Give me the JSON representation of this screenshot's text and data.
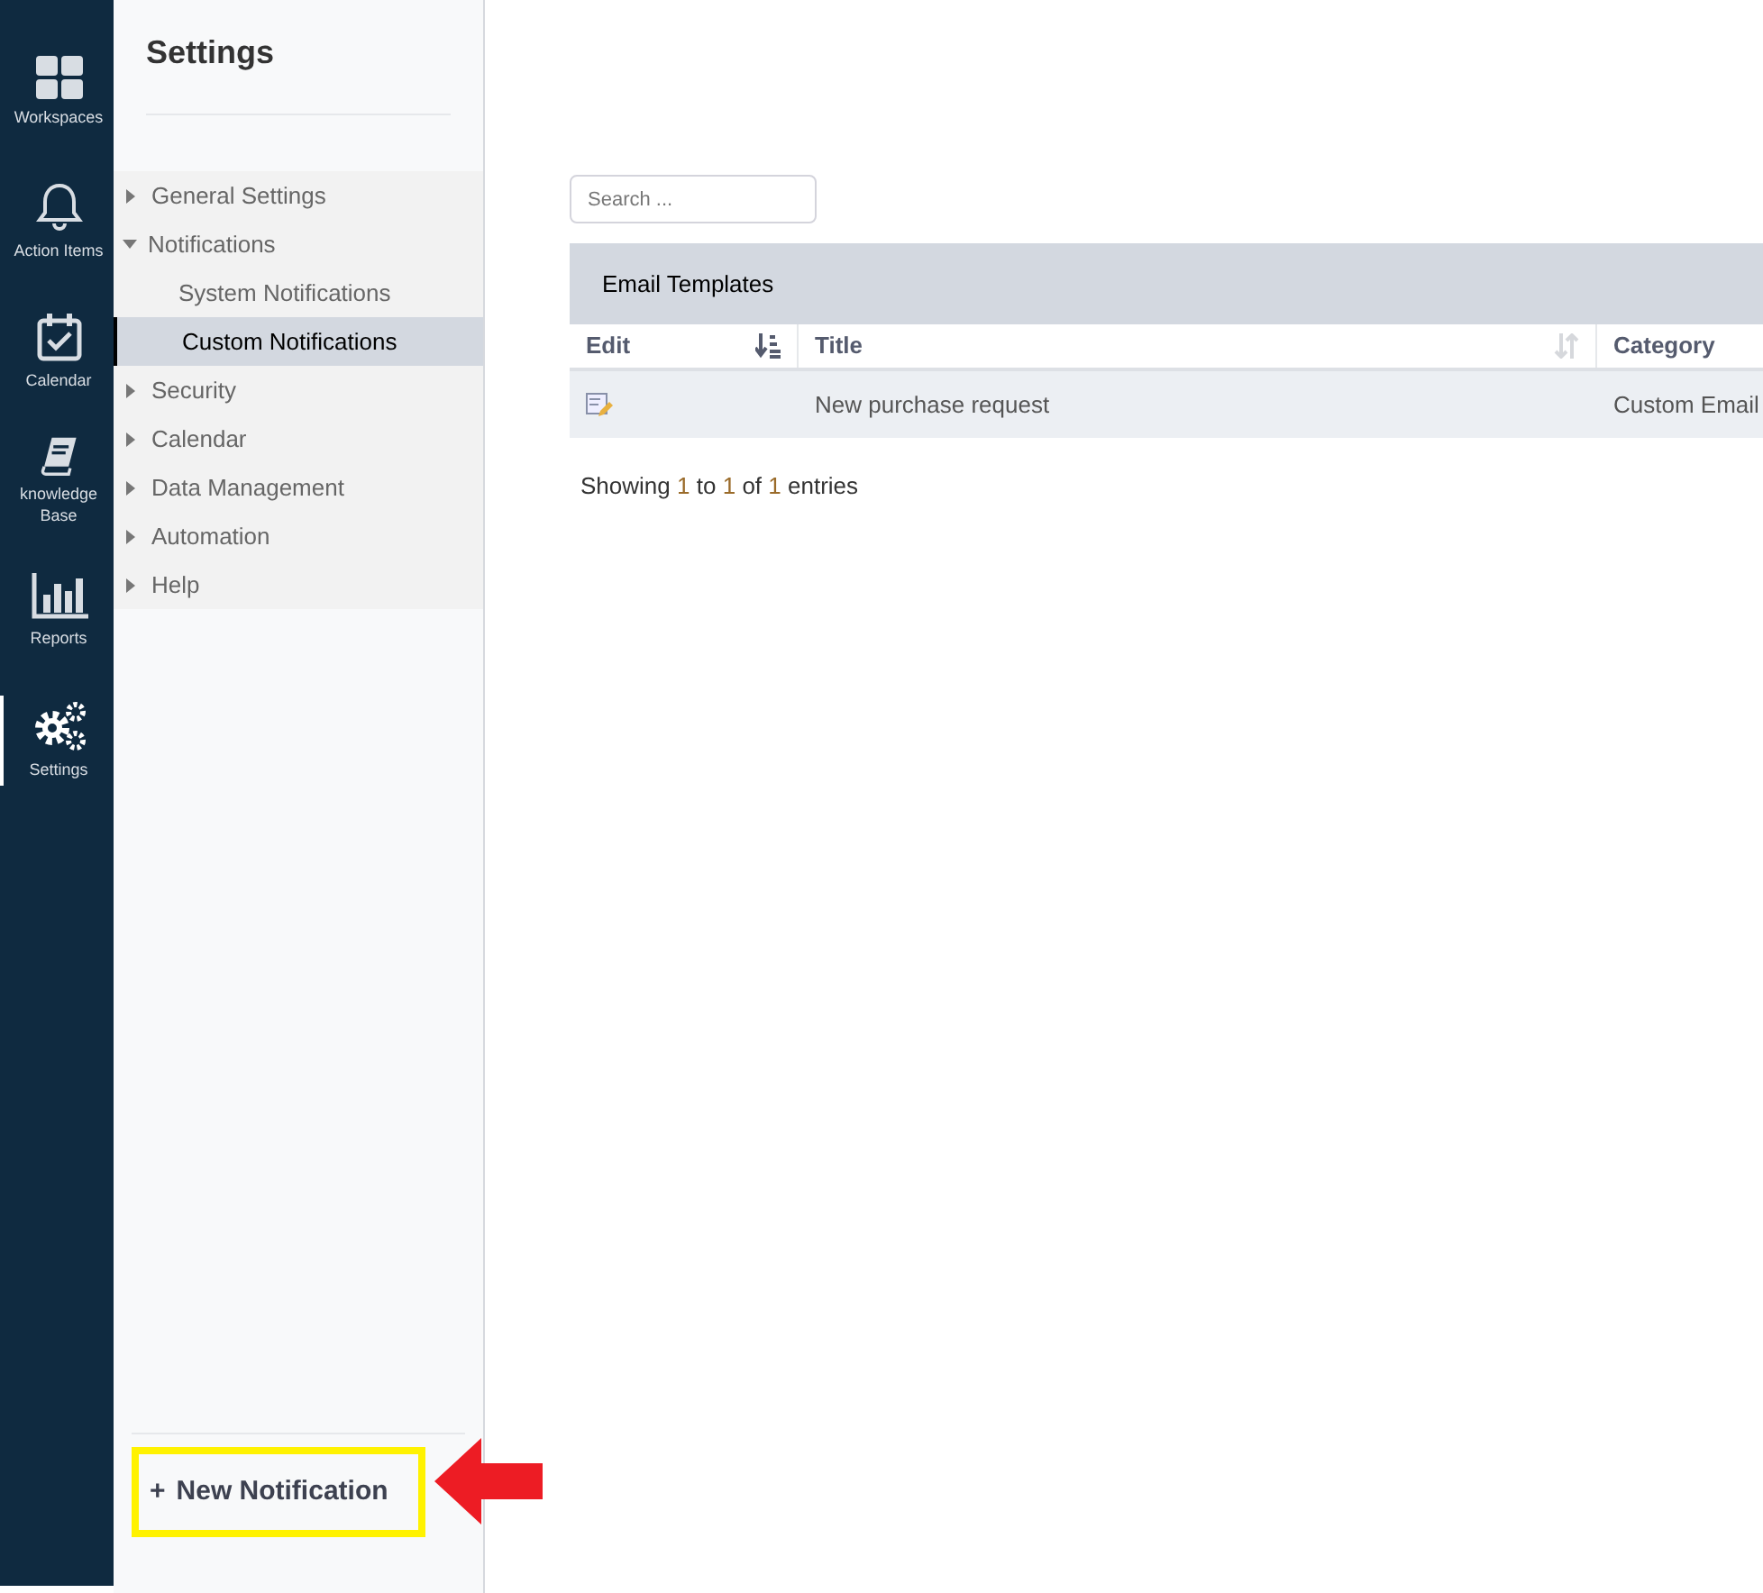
{
  "nav_rail": [
    {
      "kind": "workspaces",
      "label": "Workspaces",
      "selected": false
    },
    {
      "kind": "bell",
      "label": "Action Items",
      "selected": false
    },
    {
      "kind": "calendar",
      "label": "Calendar",
      "selected": false
    },
    {
      "kind": "book",
      "label": "knowledge Base",
      "selected": false
    },
    {
      "kind": "reports",
      "label": "Reports",
      "selected": false
    },
    {
      "kind": "gears",
      "label": "Settings",
      "selected": true
    }
  ],
  "settings_panel": {
    "title": "Settings",
    "tree": [
      {
        "label": "General Settings",
        "expanded": false,
        "selected": false
      },
      {
        "label": "Notifications",
        "expanded": true,
        "selected": false,
        "children": [
          {
            "label": "System Notifications",
            "selected": false
          },
          {
            "label": "Custom Notifications",
            "selected": true
          }
        ]
      },
      {
        "label": "Security",
        "expanded": false,
        "selected": false
      },
      {
        "label": "Calendar",
        "expanded": false,
        "selected": false
      },
      {
        "label": "Data Management",
        "expanded": false,
        "selected": false
      },
      {
        "label": "Automation",
        "expanded": false,
        "selected": false
      },
      {
        "label": "Help",
        "expanded": false,
        "selected": false
      }
    ],
    "new_button": {
      "icon": "+",
      "label": "New Notification",
      "highlighted": true
    }
  },
  "search": {
    "placeholder": "Search ..."
  },
  "table": {
    "title": "Email Templates",
    "columns": [
      {
        "label": "Edit",
        "kind": "sorted"
      },
      {
        "label": "Title",
        "kind": "sortable"
      },
      {
        "label": "Category",
        "kind": "plain"
      }
    ],
    "rows": [
      {
        "title": "New purchase request",
        "category": "Custom Email"
      }
    ],
    "info": [
      {
        "kind": "text",
        "text": "Showing"
      },
      {
        "kind": "number",
        "text": "1"
      },
      {
        "kind": "text",
        "text": "to"
      },
      {
        "kind": "number",
        "text": "1"
      },
      {
        "kind": "text",
        "text": "of"
      },
      {
        "kind": "number",
        "text": "1"
      },
      {
        "kind": "text",
        "text": "entries"
      }
    ]
  }
}
